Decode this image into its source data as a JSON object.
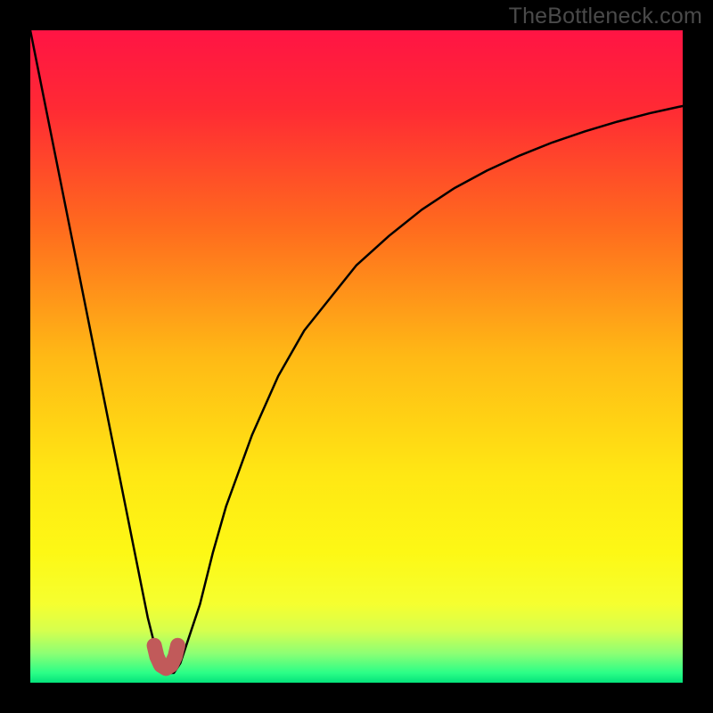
{
  "watermark": "TheBottleneck.com",
  "chart_data": {
    "type": "line",
    "title": "",
    "xlabel": "",
    "ylabel": "",
    "xlim": [
      0,
      100
    ],
    "ylim": [
      0,
      100
    ],
    "gradient_stops": [
      {
        "offset": 0.0,
        "color": "#ff1444"
      },
      {
        "offset": 0.12,
        "color": "#ff2a34"
      },
      {
        "offset": 0.3,
        "color": "#ff6a1e"
      },
      {
        "offset": 0.5,
        "color": "#ffb915"
      },
      {
        "offset": 0.68,
        "color": "#ffe714"
      },
      {
        "offset": 0.8,
        "color": "#fdf815"
      },
      {
        "offset": 0.88,
        "color": "#f5ff30"
      },
      {
        "offset": 0.92,
        "color": "#d6ff4e"
      },
      {
        "offset": 0.955,
        "color": "#8dff74"
      },
      {
        "offset": 0.985,
        "color": "#2bfe87"
      },
      {
        "offset": 1.0,
        "color": "#04e27b"
      }
    ],
    "series": [
      {
        "name": "bottleneck-curve",
        "x": [
          0,
          2,
          4,
          6,
          8,
          10,
          12,
          14,
          16,
          17,
          18,
          19,
          20,
          21,
          22,
          23,
          24,
          26,
          28,
          30,
          34,
          38,
          42,
          46,
          50,
          55,
          60,
          65,
          70,
          75,
          80,
          85,
          90,
          95,
          100
        ],
        "y": [
          100,
          90,
          80,
          70,
          60,
          50,
          40,
          30,
          20,
          15,
          10,
          6,
          3,
          1.5,
          1.5,
          3,
          6,
          12,
          20,
          27,
          38,
          47,
          54,
          59,
          64,
          68.5,
          72.5,
          75.8,
          78.5,
          80.8,
          82.8,
          84.5,
          86,
          87.3,
          88.4
        ]
      }
    ],
    "marker": {
      "name": "low-point-marker",
      "color": "#c15a5a",
      "points": [
        {
          "x": 19.0,
          "y": 5.7
        },
        {
          "x": 19.4,
          "y": 4.0
        },
        {
          "x": 20.0,
          "y": 2.7
        },
        {
          "x": 20.8,
          "y": 2.2
        },
        {
          "x": 21.6,
          "y": 2.7
        },
        {
          "x": 22.2,
          "y": 4.0
        },
        {
          "x": 22.6,
          "y": 5.7
        }
      ]
    }
  }
}
